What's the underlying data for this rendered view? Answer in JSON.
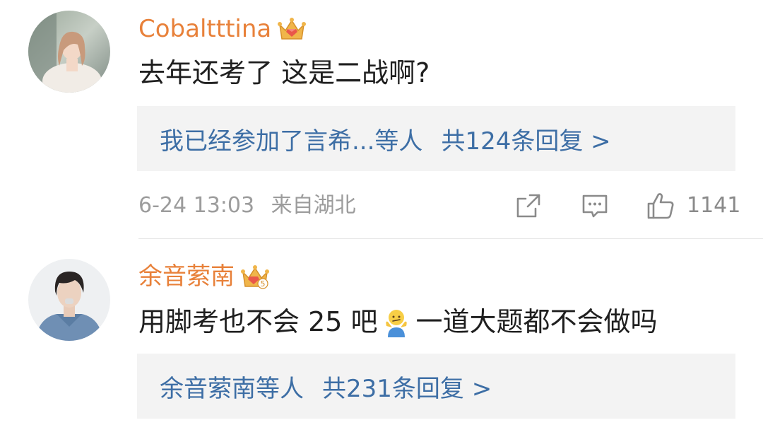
{
  "comments": [
    {
      "username": "Cobaltttina",
      "badge_icon": "crown-vip-icon",
      "text": "去年还考了 这是二战啊?",
      "replies_names": "我已经参加了言希...等人",
      "replies_count": "共124条回复 >",
      "date": "6-24 13:03",
      "location": "来自湖北",
      "likes": "1141"
    },
    {
      "username": "余音萦南",
      "badge_icon": "crown-vip-5-icon",
      "badge_level": "5",
      "text_before": "用脚考也不会 25 吧",
      "emoji": "person-shrugging-emoji",
      "text_after": "一道大题都不会做吗",
      "replies_names": "余音萦南等人",
      "replies_count": "共231条回复 >"
    }
  ],
  "colors": {
    "username": "#e8813a",
    "reply_link": "#3d6ea5",
    "reply_box_bg": "#f3f3f3",
    "meta_text": "#9c9c9c",
    "body_text": "#1f1f1f"
  }
}
